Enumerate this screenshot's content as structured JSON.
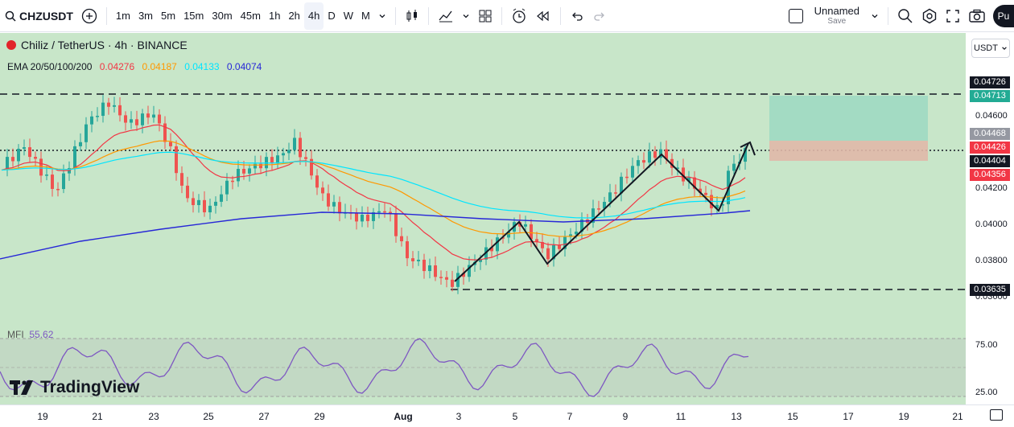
{
  "toolbar": {
    "symbol": "CHZUSDT",
    "intervals": [
      "1m",
      "3m",
      "5m",
      "15m",
      "30m",
      "45m",
      "1h",
      "2h",
      "4h",
      "D",
      "W",
      "M"
    ],
    "active_interval": "4h",
    "layout_name": "Unnamed",
    "save_label": "Save",
    "publish_label": "Pu",
    "icons": [
      "add-symbol-icon",
      "chevron-down-icon",
      "candles-icon",
      "indicators-icon",
      "templates-icon",
      "alert-icon",
      "replay-icon",
      "undo-icon",
      "redo-icon",
      "search-icon",
      "settings-icon",
      "fullscreen-icon",
      "camera-icon"
    ]
  },
  "legend": {
    "title": "Chiliz / TetherUS · 4h · BINANCE",
    "ema_label": "EMA 20/50/100/200",
    "ema_values": [
      {
        "value": "0.04276",
        "color": "#f23645"
      },
      {
        "value": "0.04187",
        "color": "#ff9800"
      },
      {
        "value": "0.04133",
        "color": "#00e5ff"
      },
      {
        "value": "0.04074",
        "color": "#2727d7"
      }
    ]
  },
  "currency_button": "USDT",
  "mfi": {
    "label": "MFI",
    "value": "55.62",
    "levels": [
      "75.00",
      "25.00"
    ]
  },
  "branding": "TradingView",
  "price_axis": {
    "ticks": [
      "0.04600",
      "0.04200",
      "0.04000",
      "0.03800",
      "0.03600"
    ],
    "labels": [
      {
        "text": "0.04726",
        "bg": "#131722",
        "color": "#ffffff"
      },
      {
        "text": "0.04713",
        "bg": "#22ab94",
        "color": "#ffffff"
      },
      {
        "text": "0.04468",
        "bg": "#9598a1",
        "color": "#ffffff"
      },
      {
        "text": "0.04426",
        "bg": "#f23645",
        "color": "#ffffff"
      },
      {
        "text": "0.04404",
        "bg": "#131722",
        "color": "#ffffff"
      },
      {
        "text": "0.04356",
        "bg": "#f23645",
        "color": "#ffffff"
      },
      {
        "text": "0.03635",
        "bg": "#131722",
        "color": "#ffffff"
      }
    ]
  },
  "date_axis": [
    "19",
    "21",
    "23",
    "25",
    "27",
    "29",
    "Aug",
    "3",
    "5",
    "7",
    "9",
    "11",
    "13",
    "15",
    "17",
    "19",
    "21"
  ],
  "colors": {
    "background": "#c8e6c9",
    "up": "#26a69a",
    "down": "#ef5350",
    "mfi_line": "#7e57c2"
  }
}
